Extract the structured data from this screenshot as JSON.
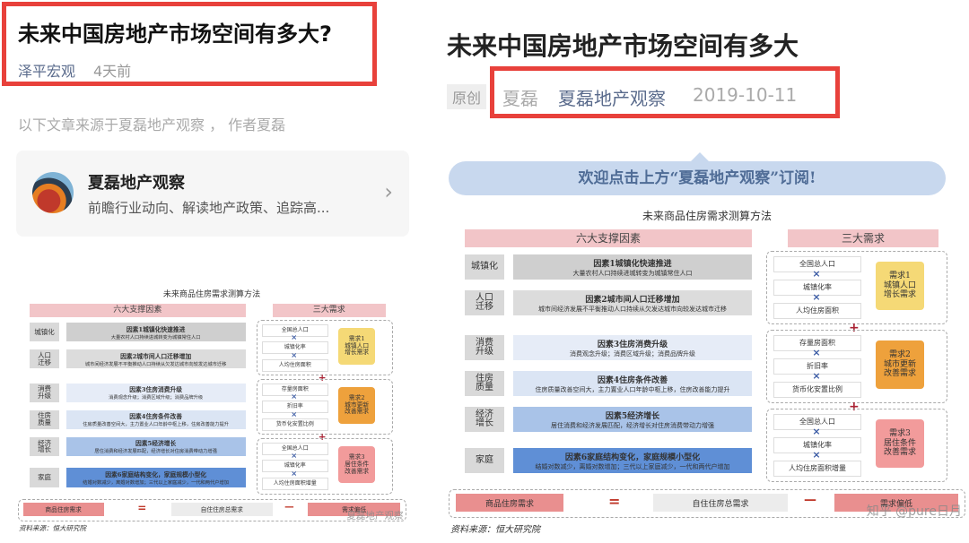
{
  "left": {
    "title": "未来中国房地产市场空间有多大?",
    "author": "泽平宏观",
    "time": "4天前",
    "intro": "以下文章来源于夏磊地产观察 ， 作者夏磊",
    "card": {
      "name": "夏磊地产观察",
      "desc": "前瞻行业动向、解读地产政策、追踪高...",
      "chevron": "›"
    },
    "watermark": "夏磊地产观察"
  },
  "right": {
    "title": "未来中国房地产市场空间有多大",
    "badge": "原创",
    "author": "夏磊",
    "account": "夏磊地产观察",
    "date": "2019-10-11",
    "welcome": "欢迎点击上方“夏磊地产观察”订阅!",
    "watermark": "知乎 @pure日月"
  },
  "diagram": {
    "title": "未来商品住房需求测算方法",
    "left_header": "六大支撑因素",
    "right_header": "三大需求",
    "factors": [
      {
        "label": "城镇化",
        "title": "因素1城镇化快速推进",
        "desc": "大量农村人口持续进城转变为城镇常住人口",
        "color": "#cfcfcf"
      },
      {
        "label": "人口\n迁移",
        "title": "因素2城市间人口迁移增加",
        "desc": "城市间经济发展不平衡推动人口持续从欠发达城市向较发达城市迁移",
        "color": "#dcdcdc"
      },
      {
        "label": "消费\n升级",
        "title": "因素3住房消费升级",
        "desc": "消费观念升级；消费区域升级；消费品牌升级",
        "color": "#e6ecf7"
      },
      {
        "label": "住房\n质量",
        "title": "因素4住房条件改善",
        "desc": "住房质量改善空间大，主力置业人口年龄中枢上移，住房改善能力提升",
        "color": "#dbe5f4"
      },
      {
        "label": "经济\n增长",
        "title": "因素5经济增长",
        "desc": "居住消费和经济发展匹配，经济增长对住房消费带动力增强",
        "color": "#a9c3e8"
      },
      {
        "label": "家庭",
        "title": "因素6家庭结构变化，家庭规模小型化",
        "desc": "结婚对数减少，离婚对数增加；三代以上家庭减少，一代和两代户增加",
        "color": "#5f8fd6"
      }
    ],
    "groups": [
      {
        "items": [
          "全国总人口",
          "城镇化率",
          "人均住房面积"
        ],
        "result": "需求1\n城镇人口\n增长需求",
        "color": "#f5d976"
      },
      {
        "items": [
          "存量房面积",
          "折旧率",
          "货币化安置比例"
        ],
        "result": "需求2\n城市更新\n改善需求",
        "color": "#eea13c"
      },
      {
        "items": [
          "全国总人口",
          "城镇化率",
          "人均住房面积增量"
        ],
        "result": "需求3\n居住条件\n改善需求",
        "color": "#f29b9b"
      }
    ],
    "x": "×",
    "plus": "+",
    "bottom": {
      "a": "商品住房需求",
      "eq": "=",
      "b": "自住住房总需求",
      "minus": "—",
      "c": "需求偏低"
    },
    "source": "资料来源：恒大研究院"
  },
  "colors": {
    "highlight": "#e8413b",
    "accent": "#5a6b8c"
  }
}
